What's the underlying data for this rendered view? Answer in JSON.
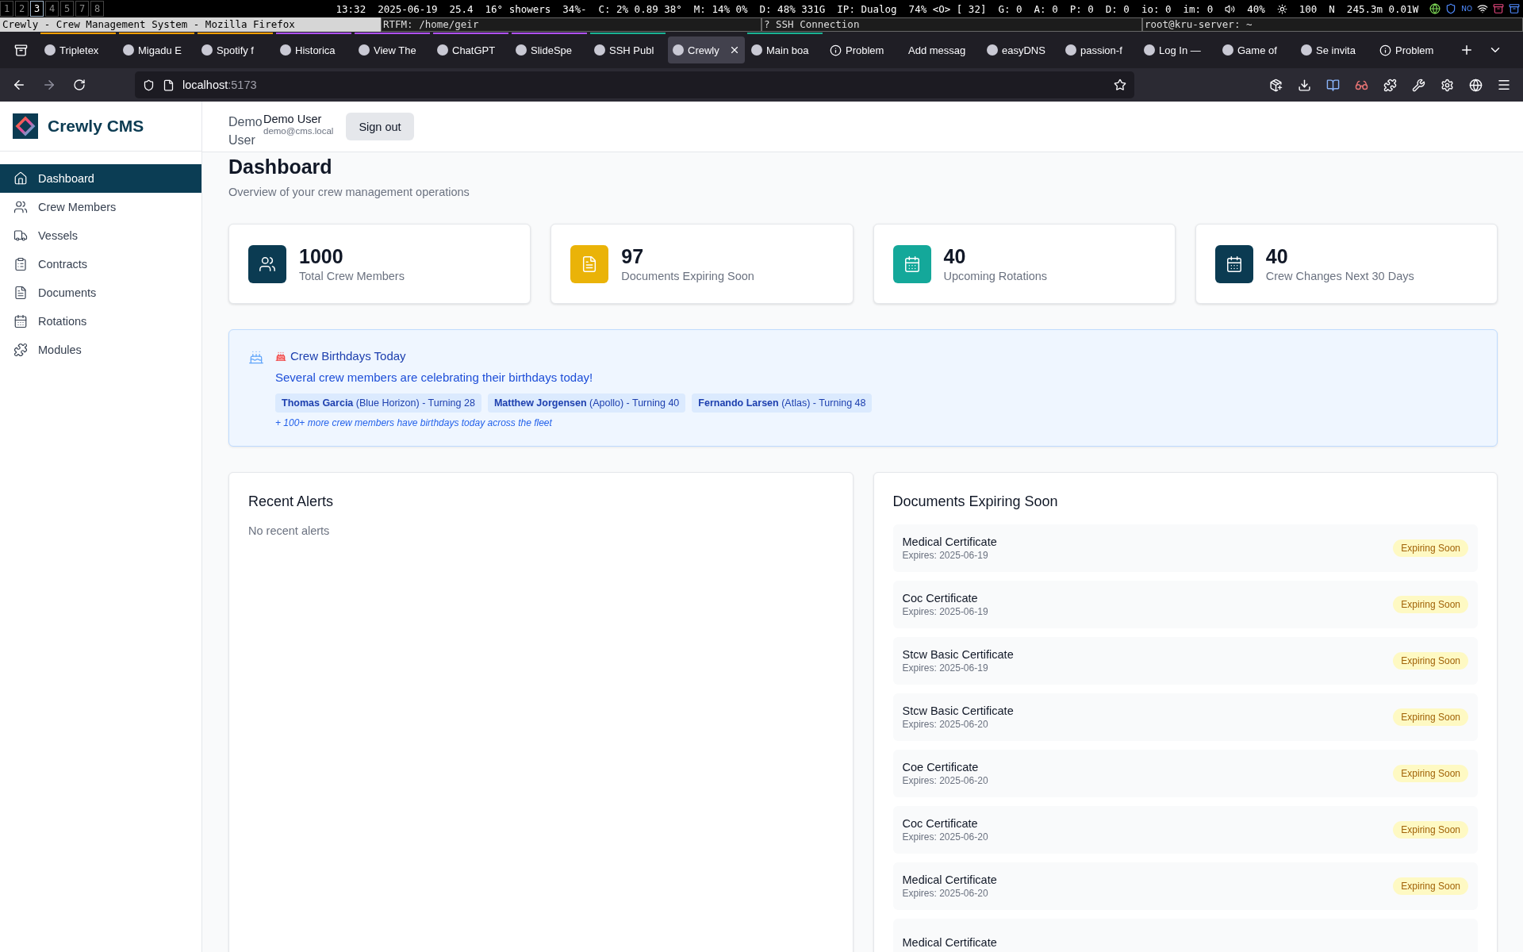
{
  "status_bar": {
    "workspaces": [
      {
        "label": "1",
        "selected": false
      },
      {
        "label": "2",
        "selected": false
      },
      {
        "label": "3",
        "selected": true
      },
      {
        "label": "4",
        "selected": false
      },
      {
        "label": "5",
        "selected": false
      },
      {
        "label": "7",
        "selected": false
      },
      {
        "label": "8",
        "selected": false
      }
    ],
    "segments": [
      "13:32",
      "2025-06-19",
      "25.4",
      "16° showers",
      "34%-",
      "C:  2% 0.89 38°",
      "M: 14% 0%",
      "D: 48% 331G",
      "IP: Dualog",
      "74% <O> [  32]",
      "G: 0",
      "A: 0",
      "P: 0",
      "D: 0",
      "io: 0",
      "im: 0"
    ],
    "volume": "40%",
    "brightness": "100",
    "layout": "N",
    "network": "245.3m 0.01W",
    "tray_label": "NO"
  },
  "window_titles": [
    {
      "title": "Crewly - Crew Management System - Mozilla Firefox",
      "selected": true
    },
    {
      "title": "RTFM: /home/geir",
      "selected": false
    },
    {
      "title": "? SSH Connection",
      "selected": false
    },
    {
      "title": "root@kru-server: ~",
      "selected": false
    }
  ],
  "browser": {
    "tabs": [
      {
        "label": "Tripletex",
        "kind": "site",
        "selected": false,
        "color": "#ff9f00"
      },
      {
        "label": "Migadu E",
        "kind": "site",
        "selected": false,
        "color": "#ff9f00"
      },
      {
        "label": "Spotify f",
        "kind": "site",
        "selected": false,
        "color": "#ff9f00"
      },
      {
        "label": "Historica",
        "kind": "site",
        "selected": false,
        "color": "#af51f5"
      },
      {
        "label": "View The",
        "kind": "site",
        "selected": false,
        "color": "#af51f5"
      },
      {
        "label": "ChatGPT",
        "kind": "site",
        "selected": false,
        "color": "#af51f5"
      },
      {
        "label": "SlideSpe",
        "kind": "site",
        "selected": false,
        "color": "#af51f5"
      },
      {
        "label": "SSH Publ",
        "kind": "site",
        "selected": false,
        "color": "#1ab394"
      },
      {
        "label": "Crewly",
        "kind": "site",
        "selected": true
      },
      {
        "label": "Main boa",
        "kind": "site",
        "selected": false,
        "color": "#1ab394"
      },
      {
        "label": "Problem",
        "kind": "info",
        "selected": false
      },
      {
        "label": "Add messag",
        "kind": "blank",
        "selected": false
      },
      {
        "label": "easyDNS",
        "kind": "site",
        "selected": false
      },
      {
        "label": "passion-f",
        "kind": "site",
        "selected": false
      },
      {
        "label": "Log In —",
        "kind": "site",
        "selected": false
      },
      {
        "label": "Game of",
        "kind": "site",
        "selected": false
      },
      {
        "label": "Se invita",
        "kind": "site",
        "selected": false
      },
      {
        "label": "Problem",
        "kind": "info",
        "selected": false
      }
    ],
    "url_host": "localhost",
    "url_port": ":5173"
  },
  "sidebar": {
    "brand": "Crewly CMS",
    "items": [
      {
        "label": "Dashboard",
        "kind": "home",
        "selected": true
      },
      {
        "label": "Crew Members",
        "kind": "users",
        "selected": false
      },
      {
        "label": "Vessels",
        "kind": "truck",
        "selected": false
      },
      {
        "label": "Contracts",
        "kind": "clipboard",
        "selected": false
      },
      {
        "label": "Documents",
        "kind": "file",
        "selected": false
      },
      {
        "label": "Rotations",
        "kind": "calendar",
        "selected": false
      },
      {
        "label": "Modules",
        "kind": "puzzle",
        "selected": false
      }
    ]
  },
  "header": {
    "avatar_text": "Demo User",
    "user_name": "Demo User",
    "user_email": "demo@cms.local",
    "sign_out": "Sign out"
  },
  "page": {
    "title": "Dashboard",
    "subtitle": "Overview of your crew management operations"
  },
  "stats": [
    {
      "value": "1000",
      "label": "Total Crew Members",
      "kind": "users",
      "color": "#0b3b52"
    },
    {
      "value": "97",
      "label": "Documents Expiring Soon",
      "kind": "file",
      "color": "#eab308"
    },
    {
      "value": "40",
      "label": "Upcoming Rotations",
      "kind": "calendar",
      "color": "#14a89a"
    },
    {
      "value": "40",
      "label": "Crew Changes Next 30 Days",
      "kind": "calendar",
      "color": "#0b3b52"
    }
  ],
  "birthdays": {
    "title": "Crew Birthdays Today",
    "message": "Several crew members are celebrating their birthdays today!",
    "people": [
      "**Thomas Garcia** (Blue Horizon) - Turning 28",
      "**Matthew Jorgensen** (Apollo) - Turning 40",
      "**Fernando Larsen** (Atlas) - Turning 48"
    ],
    "more": "+ 100+ more crew members have birthdays today across the fleet"
  },
  "alerts": {
    "title": "Recent Alerts",
    "empty": "No recent alerts"
  },
  "documents": {
    "title": "Documents Expiring Soon",
    "items": [
      {
        "name": "Medical Certificate",
        "expires": "Expires: 2025-06-19",
        "badge": "Expiring Soon"
      },
      {
        "name": "Coc Certificate",
        "expires": "Expires: 2025-06-19",
        "badge": "Expiring Soon"
      },
      {
        "name": "Stcw Basic Certificate",
        "expires": "Expires: 2025-06-19",
        "badge": "Expiring Soon"
      },
      {
        "name": "Stcw Basic Certificate",
        "expires": "Expires: 2025-06-20",
        "badge": "Expiring Soon"
      },
      {
        "name": "Coe Certificate",
        "expires": "Expires: 2025-06-20",
        "badge": "Expiring Soon"
      },
      {
        "name": "Coc Certificate",
        "expires": "Expires: 2025-06-20",
        "badge": "Expiring Soon"
      },
      {
        "name": "Medical Certificate",
        "expires": "Expires: 2025-06-20",
        "badge": "Expiring Soon"
      },
      {
        "name": "Medical Certificate"
      }
    ]
  }
}
